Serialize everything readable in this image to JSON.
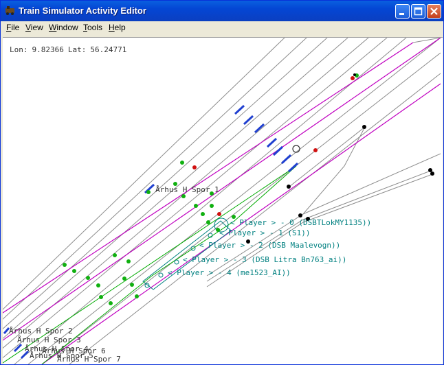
{
  "window": {
    "title": "Train Simulator Activity Editor"
  },
  "menu": {
    "items": [
      {
        "first": "F",
        "rest": "ile"
      },
      {
        "first": "V",
        "rest": "iew"
      },
      {
        "first": "W",
        "rest": "indow"
      },
      {
        "first": "T",
        "rest": "ools"
      },
      {
        "first": "H",
        "rest": "elp"
      }
    ]
  },
  "status": {
    "lon_label": "Lon:",
    "lon": "9.82366",
    "lat_label": "Lat:",
    "lat": "56.24771"
  },
  "track_labels": [
    "Århus H  Spor 1",
    "Århus H Spor 2",
    "Århus H Spor 3",
    "Århus H Spor 4",
    "Århus H Spor 5",
    "Århus H Spor 6",
    "Århus H Spor 7"
  ],
  "consist_labels": [
    "< Player > - 0 (DSBTLokMY1135))",
    "< Player > - 1 (S1))",
    "< Player > - 2 (DSB Maalevogn))",
    "< Player > - 3 (DSB Litra Bn763_ai))",
    "< Player > - 4 (me1523_AI))"
  ],
  "colors": {
    "track": "#8c8c8c",
    "route": "#c000c0",
    "green_track": "#00aa00",
    "consist": "#008080",
    "signal_blue": "#2040d0",
    "node_green": "#10b010",
    "node_red": "#d01010",
    "node_black": "#000000"
  }
}
